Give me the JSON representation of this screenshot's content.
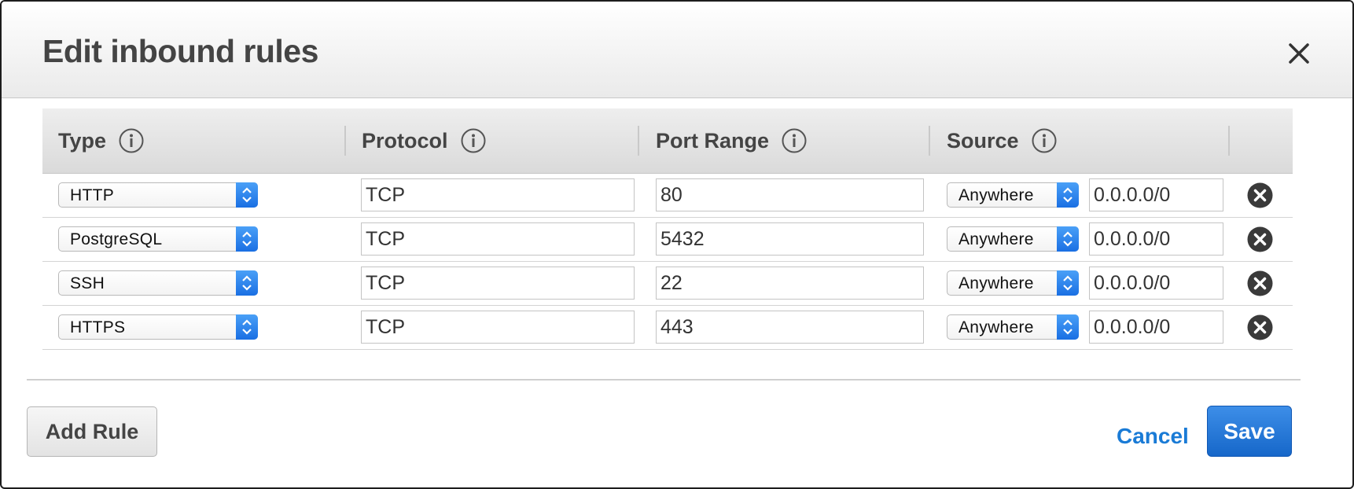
{
  "dialog": {
    "title": "Edit inbound rules",
    "close_icon": "close-icon"
  },
  "table": {
    "headers": [
      {
        "label": "Type",
        "icon": "info-icon"
      },
      {
        "label": "Protocol",
        "icon": "info-icon"
      },
      {
        "label": "Port Range",
        "icon": "info-icon"
      },
      {
        "label": "Source",
        "icon": "info-icon"
      }
    ],
    "rows": [
      {
        "type": "HTTP",
        "protocol": "TCP",
        "port_range": "80",
        "source": "Anywhere",
        "cidr": "0.0.0.0/0"
      },
      {
        "type": "PostgreSQL",
        "protocol": "TCP",
        "port_range": "5432",
        "source": "Anywhere",
        "cidr": "0.0.0.0/0"
      },
      {
        "type": "SSH",
        "protocol": "TCP",
        "port_range": "22",
        "source": "Anywhere",
        "cidr": "0.0.0.0/0"
      },
      {
        "type": "HTTPS",
        "protocol": "TCP",
        "port_range": "443",
        "source": "Anywhere",
        "cidr": "0.0.0.0/0"
      }
    ],
    "remove_icon": "remove-circle-icon"
  },
  "footer": {
    "add_rule_label": "Add Rule",
    "cancel_label": "Cancel",
    "save_label": "Save"
  },
  "colors": {
    "accent": "#1a7bd6",
    "primary_button": "#1667c9",
    "select_arrow": "#2a7fea",
    "title_text": "#444444"
  }
}
